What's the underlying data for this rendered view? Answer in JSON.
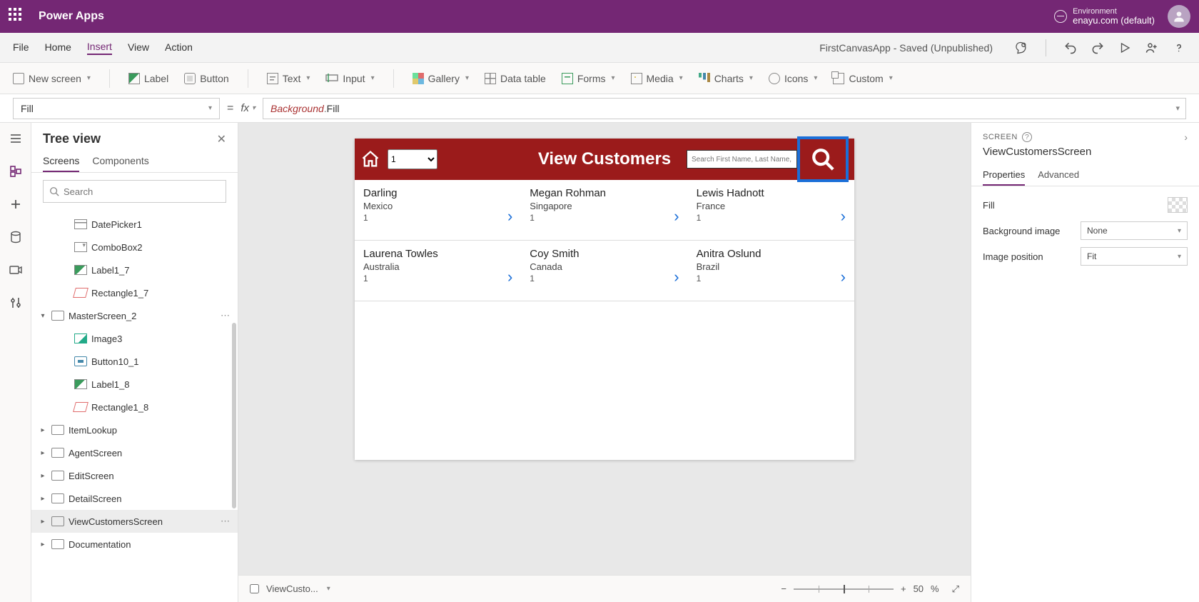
{
  "header": {
    "app_title": "Power Apps",
    "env_label": "Environment",
    "env_name": "enayu.com (default)"
  },
  "menubar": {
    "items": [
      "File",
      "Home",
      "Insert",
      "View",
      "Action"
    ],
    "active": "Insert",
    "app_status": "FirstCanvasApp - Saved (Unpublished)"
  },
  "ribbon": {
    "new_screen": "New screen",
    "label": "Label",
    "button": "Button",
    "text": "Text",
    "input": "Input",
    "gallery": "Gallery",
    "data_table": "Data table",
    "forms": "Forms",
    "media": "Media",
    "charts": "Charts",
    "icons": "Icons",
    "custom": "Custom"
  },
  "formula": {
    "property": "Fill",
    "fx": "fx",
    "expr_obj": "Background",
    "expr_dot": ".",
    "expr_prop": "Fill"
  },
  "tree": {
    "title": "Tree view",
    "tabs": {
      "screens": "Screens",
      "components": "Components"
    },
    "search_placeholder": "Search",
    "nodes": {
      "datepicker": "DatePicker1",
      "combobox": "ComboBox2",
      "label17": "Label1_7",
      "rect17": "Rectangle1_7",
      "master2": "MasterScreen_2",
      "image3": "Image3",
      "button101": "Button10_1",
      "label18": "Label1_8",
      "rect18": "Rectangle1_8",
      "itemlookup": "ItemLookup",
      "agent": "AgentScreen",
      "edit": "EditScreen",
      "detail": "DetailScreen",
      "viewcust": "ViewCustomersScreen",
      "doc": "Documentation"
    }
  },
  "canvas": {
    "title": "View Customers",
    "dropdown_value": "1",
    "search_placeholder": "Search First Name, Last Name, or Ag",
    "customers": [
      {
        "name": "Darling",
        "location": "Mexico",
        "num": "1"
      },
      {
        "name": "Megan  Rohman",
        "location": "Singapore",
        "num": "1"
      },
      {
        "name": "Lewis  Hadnott",
        "location": "France",
        "num": "1"
      },
      {
        "name": "Laurena  Towles",
        "location": "Australia",
        "num": "1"
      },
      {
        "name": "Coy  Smith",
        "location": "Canada",
        "num": "1"
      },
      {
        "name": "Anitra  Oslund",
        "location": "Brazil",
        "num": "1"
      }
    ]
  },
  "canvas_footer": {
    "crumb": "ViewCusto...",
    "zoom_value": "50",
    "zoom_unit": "%"
  },
  "props": {
    "type": "SCREEN",
    "name": "ViewCustomersScreen",
    "tabs": {
      "properties": "Properties",
      "advanced": "Advanced"
    },
    "rows": {
      "fill_label": "Fill",
      "bg_label": "Background image",
      "bg_value": "None",
      "pos_label": "Image position",
      "pos_value": "Fit"
    }
  }
}
